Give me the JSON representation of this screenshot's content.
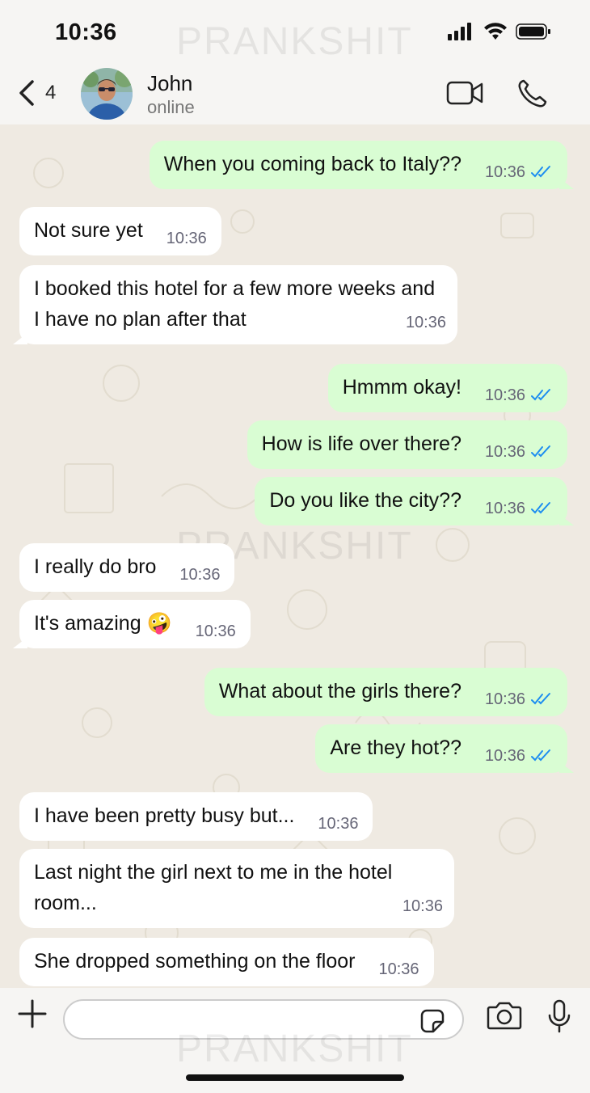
{
  "status_bar": {
    "time": "10:36"
  },
  "header": {
    "back_count": "4",
    "contact_name": "John",
    "contact_status": "online",
    "watermark": "PRANKSHIT"
  },
  "messages": [
    {
      "dir": "out",
      "text": "When you coming back to Italy??",
      "time": "10:36",
      "ticks": "read"
    },
    {
      "dir": "in",
      "text": "Not sure yet",
      "time": "10:36"
    },
    {
      "dir": "in",
      "text": "I booked this hotel for a few more weeks and I have no plan after that",
      "time": "10:36"
    },
    {
      "dir": "out",
      "text": "Hmmm okay!",
      "time": "10:36",
      "ticks": "read"
    },
    {
      "dir": "out",
      "text": "How is life over there?",
      "time": "10:36",
      "ticks": "read"
    },
    {
      "dir": "out",
      "text": "Do you like the city??",
      "time": "10:36",
      "ticks": "read"
    },
    {
      "dir": "in",
      "text": "I really do bro",
      "time": "10:36"
    },
    {
      "dir": "in",
      "text": "It's amazing 🤪",
      "time": "10:36"
    },
    {
      "dir": "out",
      "text": "What about the girls there?",
      "time": "10:36",
      "ticks": "read"
    },
    {
      "dir": "out",
      "text": "Are they hot??",
      "time": "10:36",
      "ticks": "read"
    },
    {
      "dir": "in",
      "text": "I have been pretty busy but...",
      "time": "10:36"
    },
    {
      "dir": "in",
      "text": "Last night the girl next to me in the hotel room...",
      "time": "10:36"
    },
    {
      "dir": "in",
      "text": "She dropped something on the floor",
      "time": "10:36"
    }
  ],
  "composer": {
    "input_value": ""
  },
  "colors": {
    "outgoing_bubble": "#d9fdd3",
    "incoming_bubble": "#ffffff",
    "read_ticks": "#1d8df0"
  }
}
